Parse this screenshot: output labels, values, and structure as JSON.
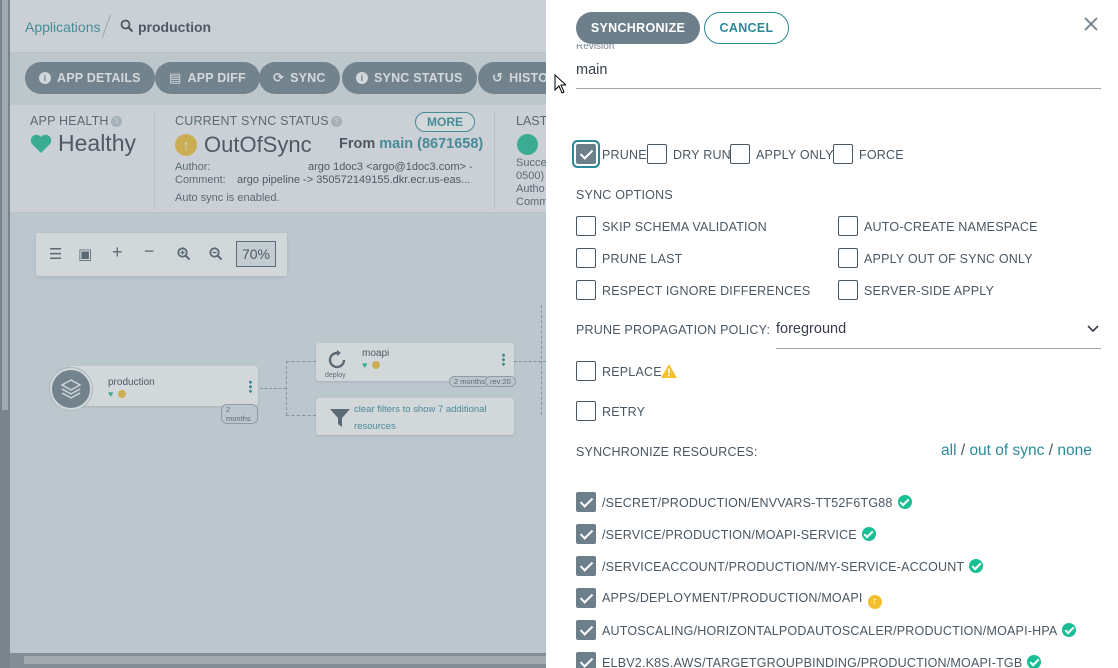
{
  "breadcrumb": {
    "link": "Applications",
    "current": "production"
  },
  "toolbar": {
    "app_details": "APP DETAILS",
    "app_diff": "APP DIFF",
    "sync": "SYNC",
    "sync_status": "SYNC STATUS",
    "history": "HISTO"
  },
  "status": {
    "health_label": "APP HEALTH",
    "health_value": "Healthy",
    "sync_label": "CURRENT SYNC STATUS",
    "sync_value": "OutOfSync",
    "from_prefix": "From",
    "from_rev": "main (8671658)",
    "more": "MORE",
    "author_label": "Author:",
    "author_value": "argo 1doc3 <argo@1doc3.com> -",
    "comment_label": "Comment:",
    "comment_value": "argo pipeline -> 350572149155.dkr.ecr.us-eas...",
    "autosync": "Auto sync is enabled.",
    "last_label": "LAST",
    "last_line1": "Succe",
    "last_line2": "0500)",
    "last_line3": "Autho",
    "last_line4": "Comm"
  },
  "graph": {
    "zoom": "70%",
    "root_name": "production",
    "root_age": "2 months",
    "child_name": "moapi",
    "child_kind": "deploy",
    "child_age": "2 months",
    "child_rev": "rev:20",
    "filter_text": "clear filters to show 7 additional resources"
  },
  "panel": {
    "synchronize": "SYNCHRONIZE",
    "cancel": "CANCEL",
    "revision_label": "Revision",
    "revision_value": "main",
    "opts": [
      {
        "label": "PRUNE",
        "checked": true
      },
      {
        "label": "DRY RUN",
        "checked": false
      },
      {
        "label": "APPLY ONLY",
        "checked": false
      },
      {
        "label": "FORCE",
        "checked": false
      }
    ],
    "sync_options_title": "SYNC OPTIONS",
    "sync_options": {
      "skip_schema": "SKIP SCHEMA VALIDATION",
      "auto_ns": "AUTO-CREATE NAMESPACE",
      "prune_last": "PRUNE LAST",
      "apply_oos": "APPLY OUT OF SYNC ONLY",
      "respect_ignore": "RESPECT IGNORE DIFFERENCES",
      "server_side": "SERVER-SIDE APPLY"
    },
    "prune_policy_label": "PRUNE PROPAGATION POLICY:",
    "prune_policy_value": "foreground",
    "replace": "REPLACE",
    "retry": "RETRY",
    "sync_resources_label": "SYNCHRONIZE RESOURCES:",
    "sel_all": "all",
    "sel_oos": "out of sync",
    "sel_none": "none",
    "resources": [
      {
        "name": "/SECRET/PRODUCTION/ENVVARS-TT52F6TG88",
        "status": "ok"
      },
      {
        "name": "/SERVICE/PRODUCTION/MOAPI-SERVICE",
        "status": "ok"
      },
      {
        "name": "/SERVICEACCOUNT/PRODUCTION/MY-SERVICE-ACCOUNT",
        "status": "ok"
      },
      {
        "name": "APPS/DEPLOYMENT/PRODUCTION/MOAPI",
        "status": "outofsync"
      },
      {
        "name": "AUTOSCALING/HORIZONTALPODAUTOSCALER/PRODUCTION/MOAPI-HPA",
        "status": "ok"
      },
      {
        "name": "ELBV2.K8S.AWS/TARGETGROUPBINDING/PRODUCTION/MOAPI-TGB",
        "status": "ok"
      }
    ]
  },
  "colors": {
    "accent": "#2b8a98",
    "button": "#6d7f8b",
    "healthy": "#18be94",
    "outofsync": "#f4c030"
  }
}
